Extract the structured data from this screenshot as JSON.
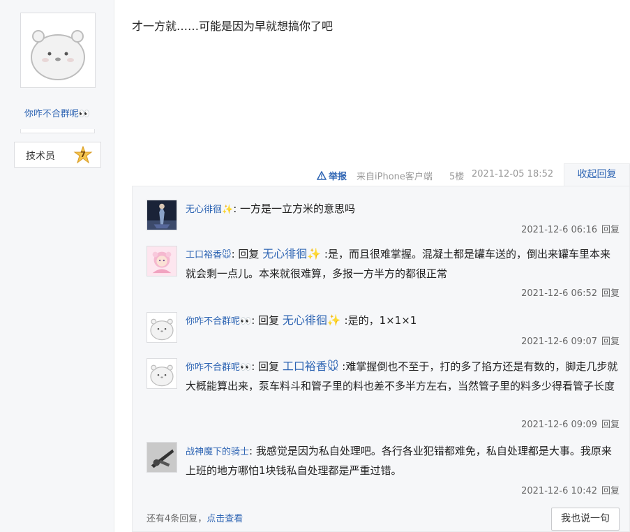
{
  "author": {
    "name": "你咋不合群呢👀",
    "level_name": "技术员",
    "level_num": "7"
  },
  "post": {
    "content": "才一方就……可能是因为早就想搞你了吧",
    "report_label": "举报",
    "client": "来自iPhone客户端",
    "floor": "5楼",
    "time": "2021-12-05 18:52",
    "collapse_label": "收起回复"
  },
  "replies": [
    {
      "user": "无心徘徊✨",
      "sep": ":",
      "reply_prefix": "",
      "reply_to": "",
      "text": "一方是一立方米的意思吗",
      "time": "2021-12-6 06:16",
      "reply_label": "回复"
    },
    {
      "user": "工口裕香🐭",
      "sep": ": 回复 ",
      "reply_prefix": "回复",
      "reply_to": "无心徘徊✨",
      "text": ":是，而且很难掌握。混凝土都是罐车送的，倒出来罐车里本来就会剩一点儿。本来就很难算，多报一方半方的都很正常",
      "time": "2021-12-6 06:52",
      "reply_label": "回复"
    },
    {
      "user": "你咋不合群呢👀",
      "sep": ": 回复 ",
      "reply_prefix": "回复",
      "reply_to": "无心徘徊✨",
      "text": ":是的，1×1×1",
      "time": "2021-12-6 09:07",
      "reply_label": "回复"
    },
    {
      "user": "你咋不合群呢👀",
      "sep": ": 回复 ",
      "reply_prefix": "回复",
      "reply_to": "工口裕香🐭",
      "text": ":难掌握倒也不至于，打的多了掐方还是有数的，脚走几步就大概能算出来，泵车料斗和管子里的料也差不多半方左右，当然管子里的料多少得看管子长度",
      "time": "2021-12-6 09:09",
      "reply_label": "回复"
    },
    {
      "user": "战神魔下的骑士",
      "sep": ":",
      "reply_prefix": "",
      "reply_to": "",
      "text": "我感觉是因为私自处理吧。各行各业犯错都难免，私自处理都是大事。我原来上班的地方哪怕1块钱私自处理都是严重过错。",
      "time": "2021-12-6 10:42",
      "reply_label": "回复"
    }
  ],
  "footer": {
    "more_text": "还有4条回复，",
    "more_link": "点击查看",
    "say_button": "我也说一句"
  },
  "colors": {
    "link": "#2d64b3",
    "panel_bg": "#f6f7f9"
  }
}
